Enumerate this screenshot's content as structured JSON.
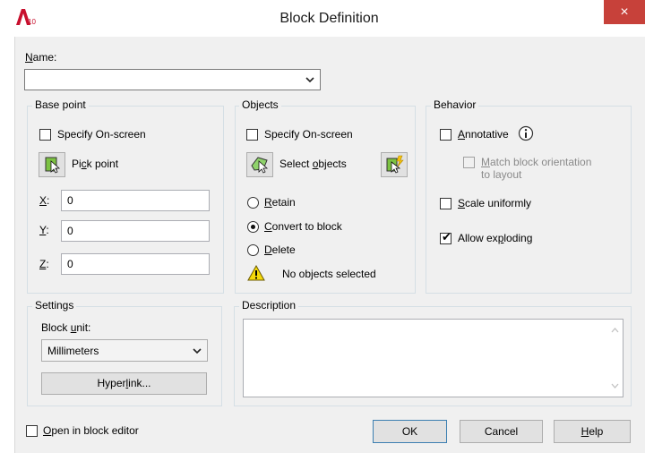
{
  "window": {
    "title": "Block Definition",
    "close_glyph": "×",
    "app_icon": "autocad-a-icon"
  },
  "name": {
    "label": "Name:",
    "value": ""
  },
  "base_point": {
    "title": "Base point",
    "specify_label": "Specify On-screen",
    "specify_checked": false,
    "pick_label": "Pick point",
    "x_label": "X:",
    "x_value": "0",
    "y_label": "Y:",
    "y_value": "0",
    "z_label": "Z:",
    "z_value": "0"
  },
  "objects": {
    "title": "Objects",
    "specify_label": "Specify On-screen",
    "specify_checked": false,
    "select_label": "Select objects",
    "retain_label": "Retain",
    "convert_label": "Convert to block",
    "delete_label": "Delete",
    "selected_option": "Convert to block",
    "warning": "No objects selected"
  },
  "behavior": {
    "title": "Behavior",
    "annotative_label": "Annotative",
    "annotative_checked": false,
    "match_line1": "Match block orientation",
    "match_line2": "to layout",
    "match_enabled": false,
    "scale_label": "Scale uniformly",
    "scale_checked": false,
    "explode_label": "Allow exploding",
    "explode_checked": true
  },
  "settings": {
    "title": "Settings",
    "unit_label": "Block unit:",
    "unit_value": "Millimeters",
    "hyperlink_label": "Hyperlink..."
  },
  "description": {
    "title": "Description",
    "value": ""
  },
  "footer": {
    "open_editor_label": "Open in block editor",
    "open_editor_checked": false,
    "ok": "OK",
    "cancel": "Cancel",
    "help": "Help"
  },
  "colors": {
    "close_button": "#c7413a",
    "dialog_bg": "#f0f0f0",
    "warning_yellow": "#f5d90a",
    "app_icon_red": "#c8102e"
  }
}
